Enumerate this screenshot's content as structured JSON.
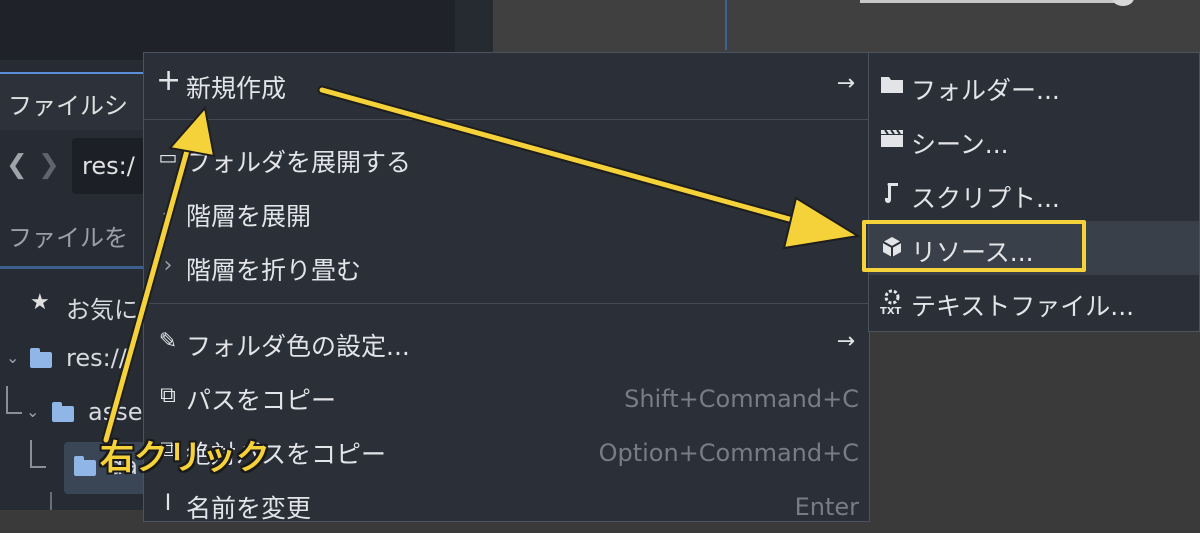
{
  "dock": {
    "tab_label": "ファイルシ",
    "back_glyph": "❮",
    "forward_glyph": "❯",
    "path_value": "res:/",
    "filter_placeholder": "ファイルを",
    "tree": {
      "favorites": "お気に",
      "root": "res://",
      "assets": "asse",
      "selected": "da"
    }
  },
  "context_menu": {
    "items": [
      {
        "icon": "plus-icon",
        "label": "新規作成",
        "has_submenu": true
      },
      {
        "icon": "folder-open-icon",
        "label": "フォルダを展開する"
      },
      {
        "icon": "chevron-icon",
        "label": "階層を展開"
      },
      {
        "icon": "chevron-icon",
        "label": "階層を折り畳む"
      },
      {
        "icon": "brush-icon",
        "label": "フォルダ色の設定...",
        "has_submenu": true
      },
      {
        "icon": "copy-icon",
        "label": "パスをコピー",
        "shortcut": "Shift+Command+C"
      },
      {
        "icon": "copy-icon",
        "label": "絶対パスをコピー",
        "shortcut": "Option+Command+C"
      },
      {
        "icon": "rename-icon",
        "label": "名前を変更",
        "shortcut": "Enter"
      }
    ]
  },
  "submenu": {
    "items": [
      {
        "icon": "folder-icon",
        "label": "フォルダー..."
      },
      {
        "icon": "clapperboard-icon",
        "label": "シーン..."
      },
      {
        "icon": "script-icon",
        "label": "スクリプト..."
      },
      {
        "icon": "cube-icon",
        "label": "リソース...",
        "highlighted": true
      },
      {
        "icon": "text-file-icon",
        "label": "テキストファイル..."
      }
    ]
  },
  "annotation": {
    "label": "右クリック",
    "color": "#f6d23a"
  }
}
